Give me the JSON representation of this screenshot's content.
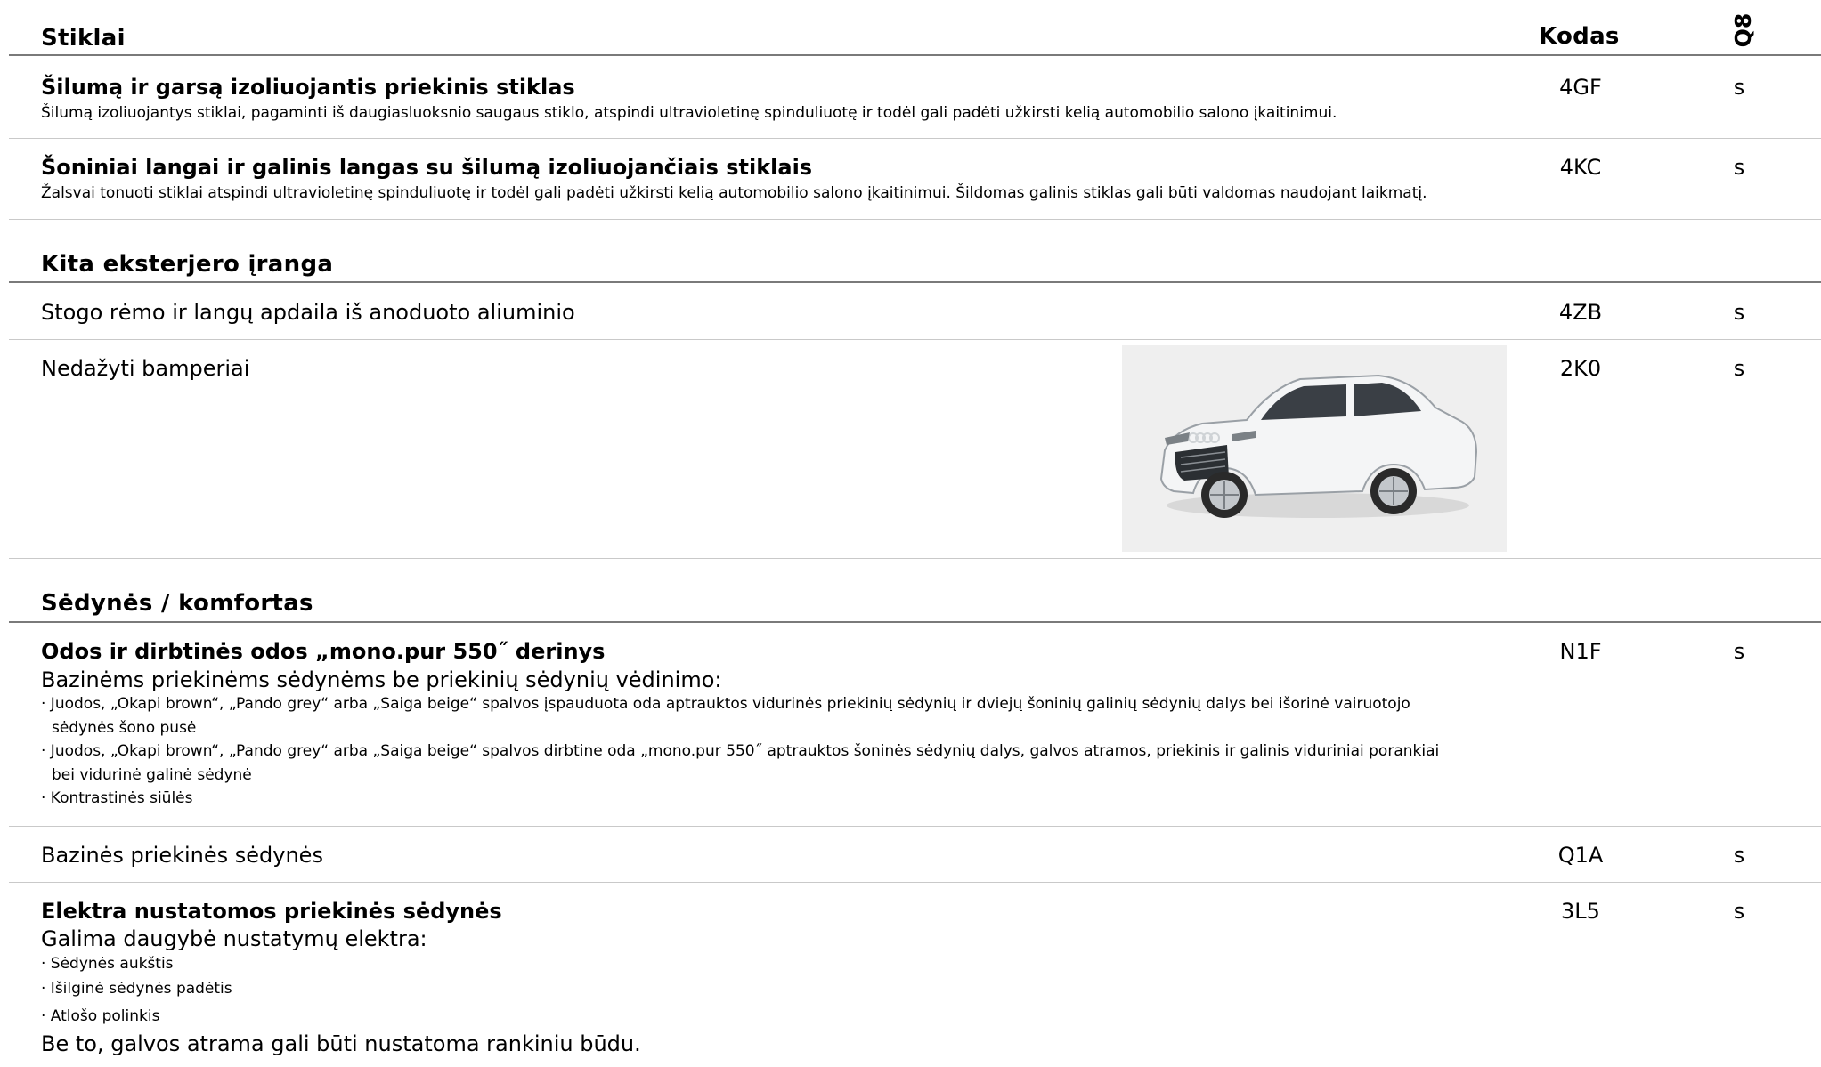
{
  "columns": {
    "code_header": "Kodas",
    "model_header": "Q8"
  },
  "sections": [
    {
      "title": "Stiklai",
      "rows": [
        {
          "title": "Šilumą ir garsą izoliuojantis priekinis stiklas",
          "desc": "Šilumą izoliuojantys stiklai, pagaminti iš daugiasluoksnio saugaus stiklo, atspindi ultravioletinę spinduliuotę ir todėl gali padėti užkirsti kelią automobilio salono įkaitinimui.",
          "code": "4GF",
          "value": "s"
        },
        {
          "title": "Šoniniai langai ir galinis langas su šilumą izoliuojančiais stiklais",
          "desc": "Žalsvai tonuoti stiklai atspindi ultravioletinę spinduliuotę ir todėl gali padėti užkirsti kelią automobilio salono įkaitinimui. Šildomas galinis stiklas gali būti valdomas naudojant laikmatį.",
          "code": "4KC",
          "value": "s"
        }
      ]
    },
    {
      "title": "Kita eksterjero įranga",
      "rows": [
        {
          "title": "Stogo rėmo ir langų apdaila iš anoduoto aliuminio",
          "code": "4ZB",
          "value": "s"
        },
        {
          "title": "Nedažyti bamperiai",
          "code": "2K0",
          "value": "s"
        }
      ]
    },
    {
      "title": "Sėdynės / komfortas",
      "rows": [
        {
          "title": "Odos ir dirbtinės odos „mono.pur 550˝ derinys",
          "subtitle": "Bazinėms priekinėms sėdynėms be priekinių sėdynių vėdinimo:",
          "bullets": [
            "· Juodos, „Okapi brown“, „Pando grey“ arba „Saiga beige“ spalvos įspauduota oda aptrauktos vidurinės priekinių sėdynių ir dviejų šoninių galinių sėdynių dalys bei išorinė vairuotojo",
            "sėdynės šono pusė",
            "· Juodos, „Okapi brown“, „Pando grey“ arba „Saiga beige“ spalvos dirbtine oda „mono.pur 550˝ aptrauktos šoninės sėdynių dalys, galvos atramos, priekinis ir galinis viduriniai porankiai",
            "bei vidurinė galinė sėdynė",
            "· Kontrastinės siūlės"
          ],
          "code": "N1F",
          "value": "s"
        },
        {
          "title": "Bazinės priekinės sėdynės",
          "code": "Q1A",
          "value": "s"
        },
        {
          "title": "Elektra nustatomos priekinės sėdynės",
          "subtitle": "Galima daugybė nustatymų elektra:",
          "bullets": [
            "· Sėdynės aukštis",
            "· Išilginė sėdynės padėtis",
            "· Atlošo polinkis"
          ],
          "footer": "Be to, galvos atrama gali būti nustatoma rankiniu būdu.",
          "code": "3L5",
          "value": "s"
        }
      ]
    }
  ],
  "colors": {
    "heavy_rule": "#7a7a7a",
    "light_rule": "#c9c9c9",
    "image_bg": "#efefef",
    "car_body": "#f4f5f6"
  },
  "image": {
    "name": "audi-q8-white-car"
  }
}
